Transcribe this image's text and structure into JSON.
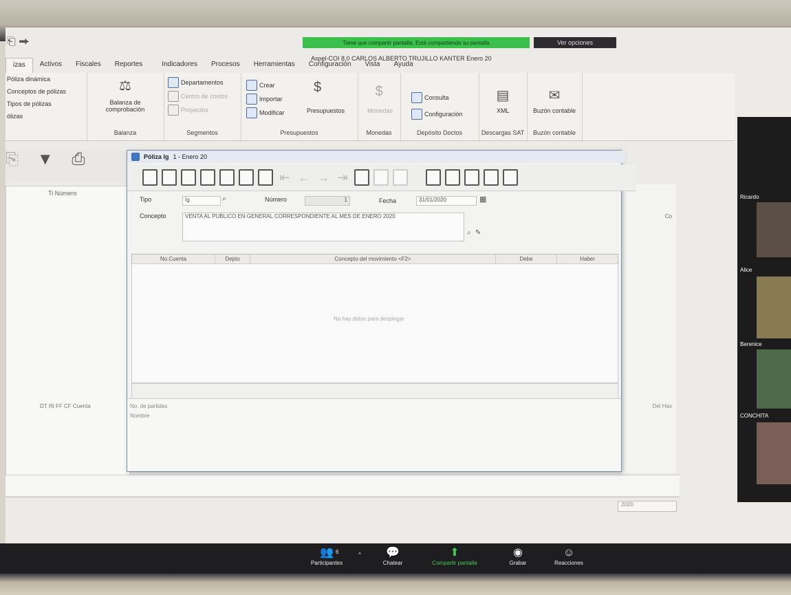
{
  "zoom_banner": {
    "share_text": "Tiene que compartir pantalla. Está compartiendo su pantalla",
    "view_options": "Ver opciones"
  },
  "window_title": "Aspel-COI 8.0 CARLOS ALBERTO TRUJILLO KANTER Enero 20",
  "menu_tabs": [
    "izas",
    "Activos",
    "Fiscales",
    "Reportes",
    "Indicadores",
    "Procesos",
    "Herramientas",
    "Configuración",
    "Vista",
    "Ayuda"
  ],
  "ribbon": {
    "polizas_items": [
      "Póliza dinámica",
      "Conceptos de pólizas",
      "Tipos de pólizas",
      "ólizas"
    ],
    "balanza_label": "Balanza de comprobación",
    "balanza_group": "Balanza",
    "segmentos_items": [
      "Departamentos",
      "Centro de costos",
      "Proyectos"
    ],
    "segmentos_group": "Segmentos",
    "presupuestos_items": [
      "Crear",
      "Importar",
      "Modificar"
    ],
    "presupuestos_big": "Presupuestos",
    "presupuestos_group": "Presupuestos",
    "monedas_label": "Monedas",
    "monedas_group": "Monedas",
    "deposito_items": [
      "Consulta",
      "Configuración"
    ],
    "deposito_group": "Depósito Doctos",
    "xml_label": "XML",
    "xml_group": "Descargas SAT",
    "buzon_label": "Buzón contable",
    "buzon_group": "Buzón contable"
  },
  "bg_list": {
    "header": "Ti Número",
    "footer_cols": "DT IN FF CF Cuenta",
    "right_head": "Co",
    "right_foot": "Del Has",
    "year": "2020"
  },
  "dialog": {
    "title": "Póliza Ig",
    "subtitle": "1 - Enero 20",
    "tipo_label": "Tipo",
    "tipo_value": "Ig",
    "numero_label": "Número",
    "numero_value": "1",
    "fecha_label": "Fecha",
    "fecha_value": "31/01/2020",
    "concepto_label": "Concepto",
    "concepto_value": "VENTA AL PUBLICO EN GENERAL CORRESPONDIENTE AL MES DE ENERO 2020",
    "columns": [
      "No.Cuenta",
      "Depto",
      "Concepto del movimiento <F2>",
      "Debe",
      "Haber"
    ],
    "empty_message": "No hay datos para desplegar",
    "partidas_label": "No. de partidas",
    "nombre_label": "Nombre"
  },
  "zoom_toolbar": {
    "participants": "Participantes",
    "participants_count": "6",
    "chat": "Chatear",
    "share": "Compartir pantalla",
    "record": "Grabar",
    "reactions": "Reacciones"
  },
  "participants": [
    "Ricardo",
    "Alice",
    "Berenice",
    "CONCHITA"
  ]
}
